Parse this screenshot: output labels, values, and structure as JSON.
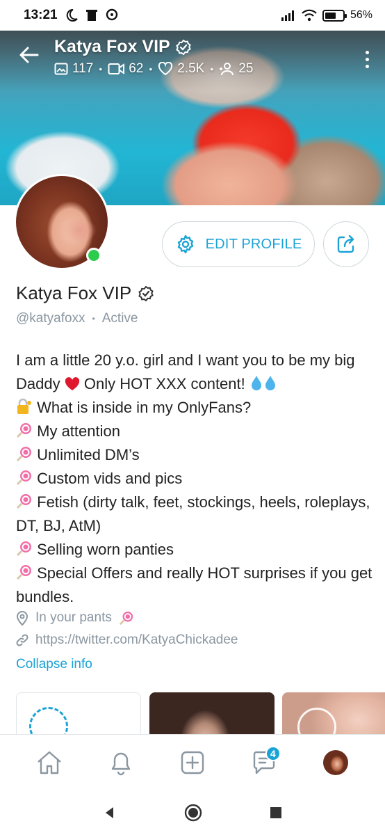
{
  "status_bar": {
    "time": "13:21",
    "battery": "56%",
    "battery_level": 0.56
  },
  "header": {
    "name": "Katya Fox VIP",
    "stats": {
      "photos": "117",
      "videos": "62",
      "likes": "2.5K",
      "fans": "25"
    }
  },
  "profile": {
    "name": "Katya Fox VIP",
    "handle": "@katyafoxx",
    "status": "Active",
    "online": true,
    "edit_button": "EDIT PROFILE"
  },
  "bio": {
    "line1": "I am a little 20 y.o. girl and I want you to be my big Daddy",
    "line1_tail": "Only HOT XXX content!",
    "question": "What is inside in my OnlyFans?",
    "items": [
      "My attention",
      "Unlimited DM’s",
      "Custom vids and pics",
      "Fetish (dirty talk, feet, stockings, heels, roleplays, DT, BJ, AtM)",
      "Selling worn panties",
      "Special Offers and really HOT surprises if you get bundles."
    ]
  },
  "location": "In your pants",
  "link": "https://twitter.com/KatyaChickadee",
  "collapse_label": "Collapse info",
  "bottom_nav": {
    "messages_badge": "4"
  },
  "colors": {
    "accent": "#1ba3d6",
    "online": "#2ecc4e",
    "muted": "#8a96a0"
  }
}
